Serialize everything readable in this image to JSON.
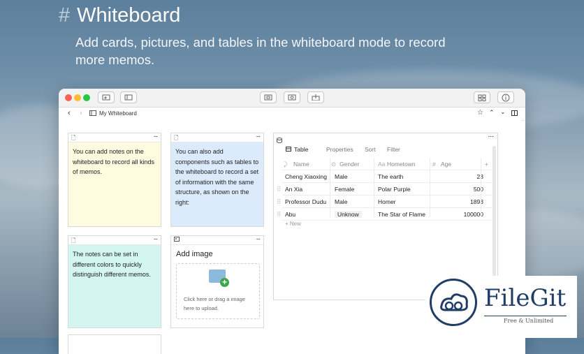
{
  "hero": {
    "hash": "#",
    "title": "Whiteboard",
    "subtitle": "Add cards, pictures, and tables in the whiteboard mode to record more memos."
  },
  "window": {
    "title": "My Whiteboard",
    "traffic_lights": [
      "#ff5f57",
      "#febc2e",
      "#28c840"
    ]
  },
  "cards": {
    "note1": "You can add notes on the whiteboard to record all kinds of memos.",
    "note2": "You can also add components such as tables to the whiteboard to record a set of information with the same structure, as shown on the right:",
    "note3": "The notes can be set in different colors to quickly distinguish different memos.",
    "image_title": "Add image",
    "image_hint": "Click here or drag a image here to upload.",
    "colors": {
      "yellow": "#fffbe0",
      "blue": "#dcebfb",
      "teal": "#d3f6f0"
    }
  },
  "table": {
    "tabs": [
      "Table",
      "Properties",
      "Sort",
      "Filter"
    ],
    "columns": [
      "Name",
      "Gender",
      "Hometown",
      "Age"
    ],
    "rows": [
      {
        "name": "Cheng Xiaoxing",
        "gender": "Male",
        "hometown": "The earth",
        "age": "23"
      },
      {
        "name": "An Xia",
        "gender": "Female",
        "hometown": "Polar Purple",
        "age": "500"
      },
      {
        "name": "Professor Dudu",
        "gender": "Male",
        "hometown": "Homer",
        "age": "1893"
      },
      {
        "name": "Abu",
        "gender": "Unknow",
        "hometown": "The Star of Flame",
        "age": "100000"
      }
    ],
    "new_label": "+ New",
    "add_column": "+"
  },
  "watermark": {
    "name": "FileGit",
    "tagline": "Free & Unlimited"
  }
}
